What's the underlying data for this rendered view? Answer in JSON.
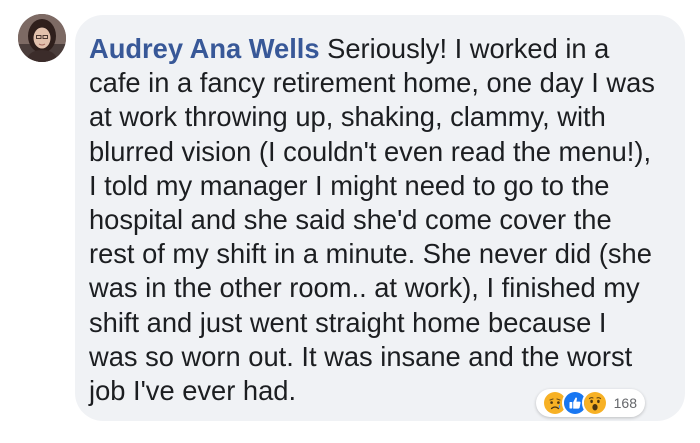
{
  "comment": {
    "author": "Audrey Ana Wells",
    "text": "Seriously! I worked in a cafe in a fancy retirement home, one day I was at work throwing up, shaking, clammy, with blurred vision (I couldn't even read the menu!), I told my manager I might need to go to the hospital and she said she'd come cover the rest of my shift in a minute. She never did (she was in the other room.. at work), I finished my shift and just went straight home because I was so worn out. It was insane and the worst job I've ever had."
  },
  "reactions": {
    "icons": [
      "sad-icon",
      "like-icon",
      "wow-icon"
    ],
    "count": "168"
  }
}
